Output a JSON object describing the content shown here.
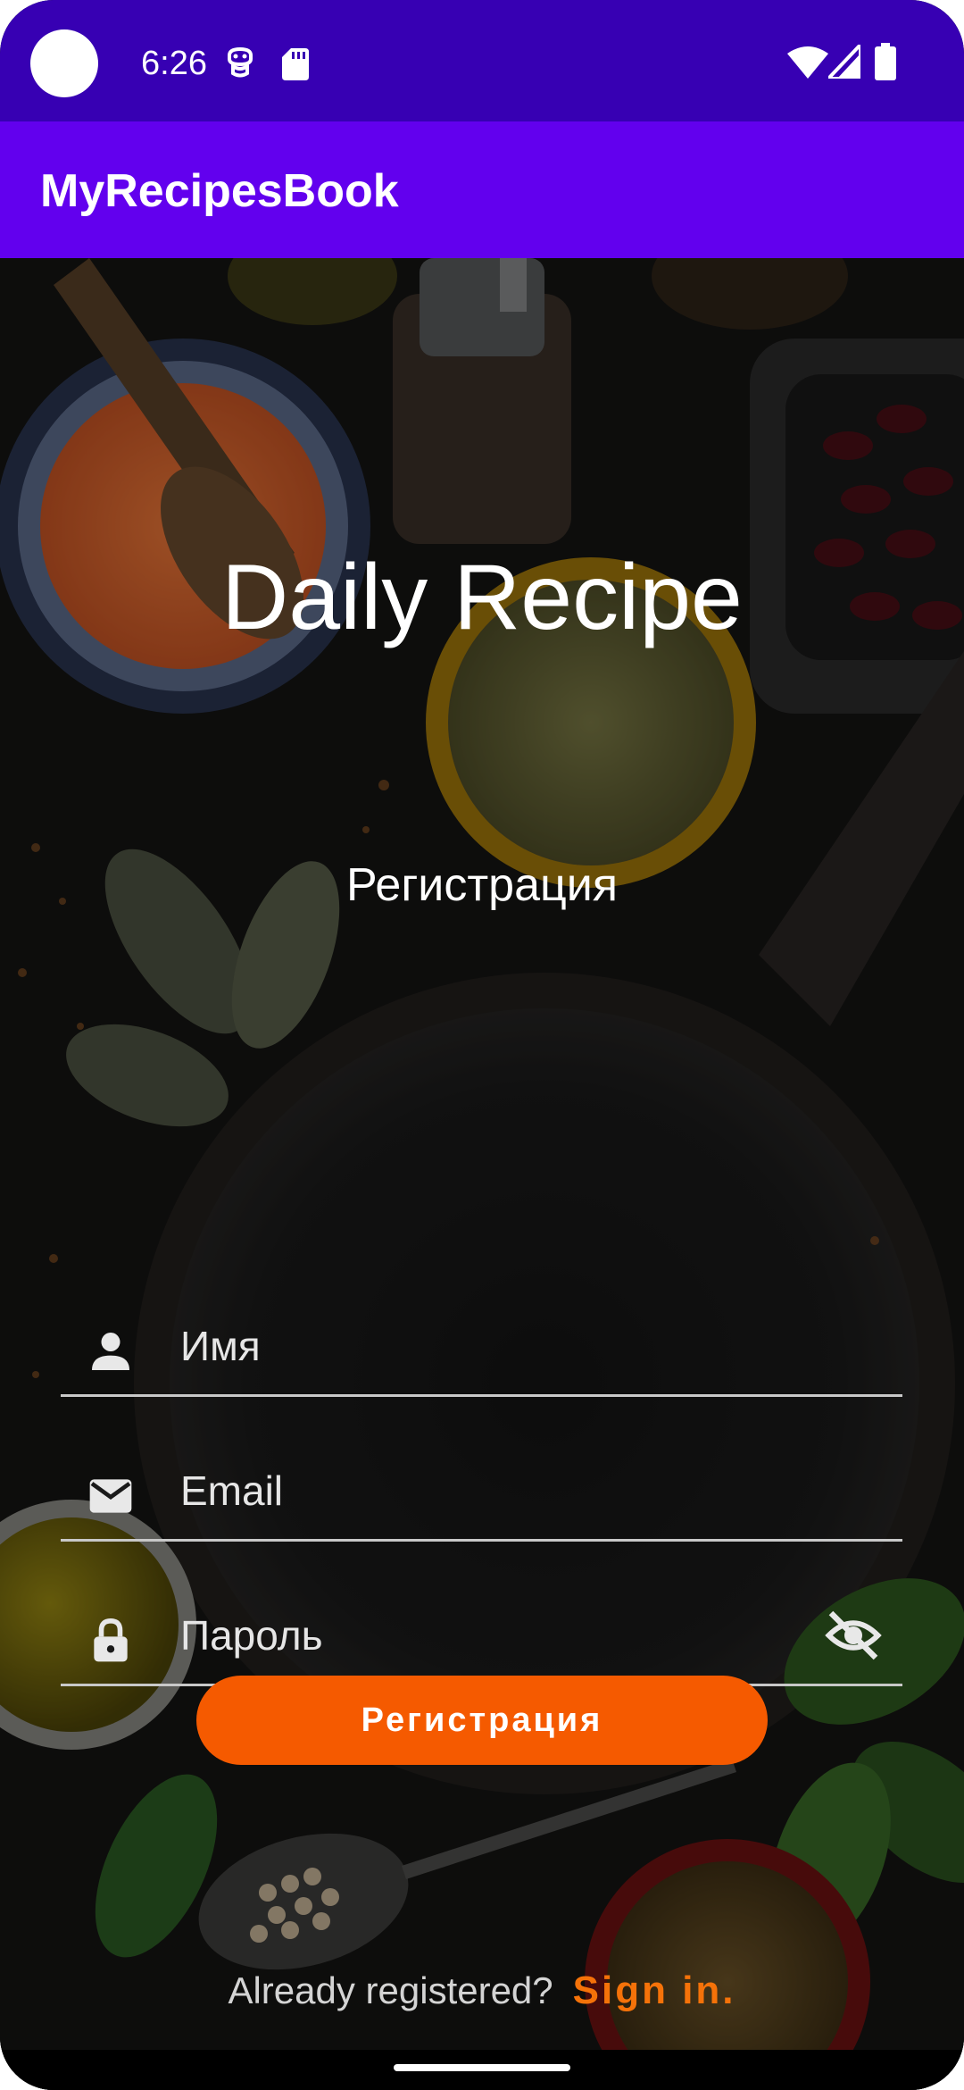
{
  "status_bar": {
    "time": "6:26",
    "icons": [
      "notification-face-icon",
      "sd-card-icon",
      "wifi-icon",
      "signal-icon",
      "battery-icon"
    ]
  },
  "app_bar": {
    "title": "MyRecipesBook",
    "color": "#6200ee"
  },
  "hero": {
    "title": "Daily Recipe",
    "subtitle": "Регистрация"
  },
  "form": {
    "name_field": {
      "placeholder": "Имя",
      "value": "",
      "icon": "person-icon"
    },
    "email_field": {
      "placeholder": "Email",
      "value": "",
      "icon": "mail-icon"
    },
    "password_field": {
      "placeholder": "Пароль",
      "value": "",
      "icon": "lock-icon",
      "toggle_icon": "visibility-off-icon"
    },
    "submit_label": "Регистрация"
  },
  "footer": {
    "prompt": "Already registered?",
    "link": "Sign in."
  },
  "colors": {
    "status_bar": "#3700b3",
    "app_bar": "#6200ee",
    "accent": "#f55a00",
    "link": "#f57209"
  }
}
